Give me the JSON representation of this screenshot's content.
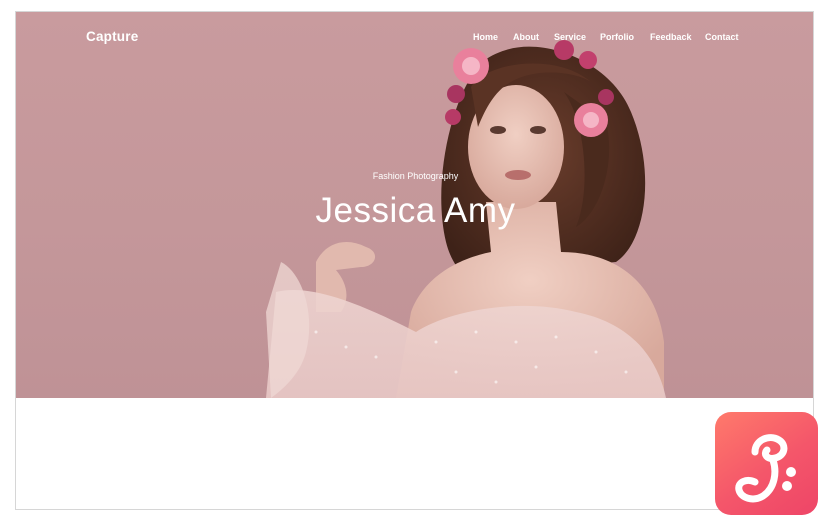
{
  "brand": "Capture",
  "nav": {
    "items": [
      {
        "label": "Home"
      },
      {
        "label": "About"
      },
      {
        "label": "Service"
      },
      {
        "label": "Porfolio"
      },
      {
        "label": "Feedback"
      },
      {
        "label": "Contact"
      }
    ]
  },
  "hero": {
    "subtitle": "Fashion Photography",
    "title": "Jessica Amy"
  },
  "badge": {
    "icon": "logo-g-icon",
    "color": "#f4566a"
  }
}
